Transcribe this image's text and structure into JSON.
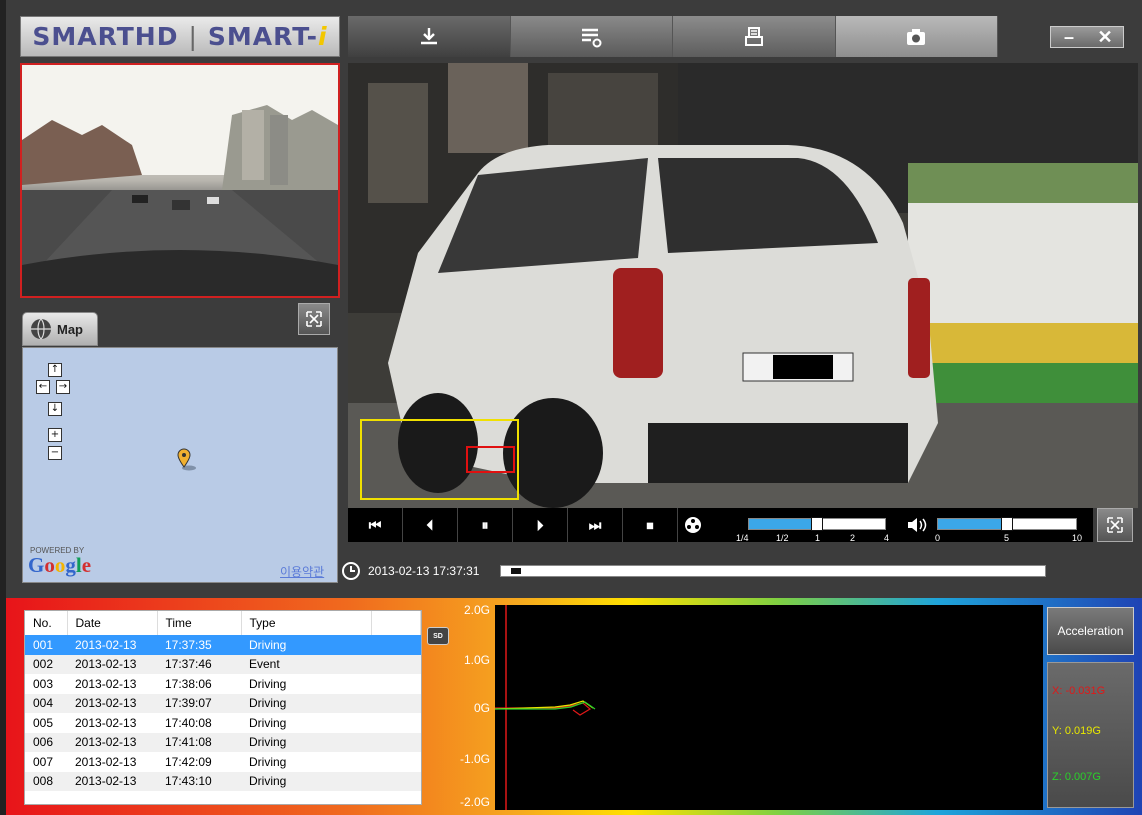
{
  "header": {
    "logo_text": "SMARTHD | SMART-i",
    "toolbar": {
      "buttons": [
        {
          "icon": "download-icon"
        },
        {
          "icon": "settings-list-icon"
        },
        {
          "icon": "print-icon"
        },
        {
          "icon": "camera-icon"
        }
      ]
    },
    "window_controls": {
      "minimize": "–",
      "close": "✕"
    }
  },
  "map": {
    "tab_label": "Map",
    "powered_by": "POWERED BY",
    "provider": "Google",
    "terms_link": "이용약관",
    "nav": {
      "up": "↑",
      "left": "←",
      "right": "→",
      "down": "↓",
      "zoom_in": "+",
      "zoom_out": "−"
    }
  },
  "player": {
    "controls": [
      "⏮",
      "⏴",
      "⏸",
      "⏵",
      "⏭",
      "⏹"
    ],
    "speed_ticks": [
      "1/4",
      "1/2",
      "1",
      "2",
      "4"
    ],
    "speed_level": 0.5,
    "volume_ticks": [
      "0",
      "5",
      "10"
    ],
    "volume_level": 0.5,
    "timestamp": "2013-02-13 17:37:31",
    "timeline_progress": 0.01
  },
  "event_list": {
    "columns": [
      "No.",
      "Date",
      "Time",
      "Type"
    ],
    "rows": [
      {
        "no": "001",
        "date": "2013-02-13",
        "time": "17:37:35",
        "type": "Driving"
      },
      {
        "no": "002",
        "date": "2013-02-13",
        "time": "17:37:46",
        "type": "Event"
      },
      {
        "no": "003",
        "date": "2013-02-13",
        "time": "17:38:06",
        "type": "Driving"
      },
      {
        "no": "004",
        "date": "2013-02-13",
        "time": "17:39:07",
        "type": "Driving"
      },
      {
        "no": "005",
        "date": "2013-02-13",
        "time": "17:40:08",
        "type": "Driving"
      },
      {
        "no": "006",
        "date": "2013-02-13",
        "time": "17:41:08",
        "type": "Driving"
      },
      {
        "no": "007",
        "date": "2013-02-13",
        "time": "17:42:09",
        "type": "Driving"
      },
      {
        "no": "008",
        "date": "2013-02-13",
        "time": "17:43:10",
        "type": "Driving"
      }
    ],
    "selected_index": 0,
    "sd_label": "SD"
  },
  "graph": {
    "y_labels": [
      "2.0G",
      "1.0G",
      "0G",
      "-1.0G",
      "-2.0G"
    ]
  },
  "acceleration": {
    "button_label": "Acceleration",
    "x": "X: -0.031G",
    "y": "Y: 0.019G",
    "z": "Z: 0.007G",
    "colors": {
      "x": "#e01818",
      "y": "#e8e800",
      "z": "#2ad02a"
    }
  }
}
